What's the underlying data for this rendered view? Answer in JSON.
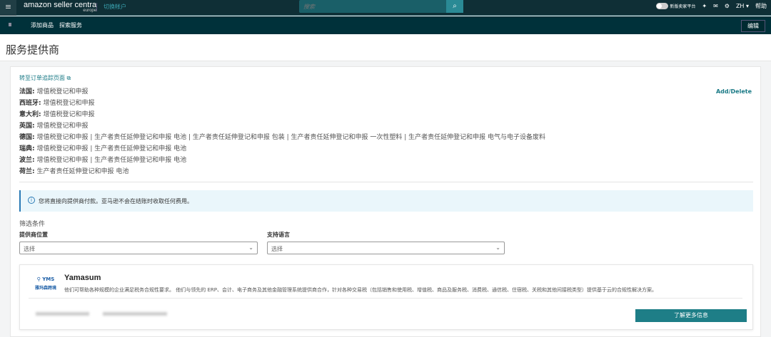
{
  "topbar": {
    "logo": "amazon seller centra",
    "logo_sub": "europe",
    "switch_account": "切换帐户",
    "search_placeholder": "搜索",
    "new_platform": "新版卖家平台",
    "lang": "ZH ▾",
    "help": "帮助"
  },
  "subnav": {
    "items": [
      "添加商品",
      "探索服务"
    ],
    "edit": "编辑"
  },
  "page_title": "服务提供商",
  "card": {
    "track_link": "转至订单追踪页面",
    "add_delete": "Add/Delete",
    "countries": [
      {
        "name": "法国:",
        "services": "增值税登记和申报"
      },
      {
        "name": "西班牙:",
        "services": "增值税登记和申报"
      },
      {
        "name": "意大利:",
        "services": "增值税登记和申报"
      },
      {
        "name": "英国:",
        "services": "增值税登记和申报"
      },
      {
        "name": "德国:",
        "services": "增值税登记和申报 | 生产者责任延伸登记和申报 电池 | 生产者责任延伸登记和申报 包装 | 生产者责任延伸登记和申报 一次性塑料 | 生产者责任延伸登记和申报 电气与电子设备废料"
      },
      {
        "name": "瑞典:",
        "services": "增值税登记和申报 | 生产者责任延伸登记和申报 电池"
      },
      {
        "name": "波兰:",
        "services": "增值税登记和申报 | 生产者责任延伸登记和申报 电池"
      },
      {
        "name": "荷兰:",
        "services": "生产者责任延伸登记和申报 电池"
      }
    ],
    "info": "您将直接向提供商付款。亚马逊不会在结账时收取任何费用。",
    "filters_title": "筛选条件",
    "filter_location_label": "提供商位置",
    "filter_location_value": "选择",
    "filter_language_label": "支持语言",
    "filter_language_value": "选择",
    "provider": {
      "logo_text": "YMS 雅玛森跨境",
      "name": "Yamasum",
      "description": "他们可帮助各种规模的企业满足税务合规性要求。 他们与领先的 ERP、会计、电子商务及其他金融管理系统提供商合作，针对各种交易税（包括销售和使用税、增值税、商品及服务税、消费税、通信税、住宿税、关税和其他间接税类型）提供基于云的合规性解决方案。",
      "more_button": "了解更多信息"
    }
  }
}
